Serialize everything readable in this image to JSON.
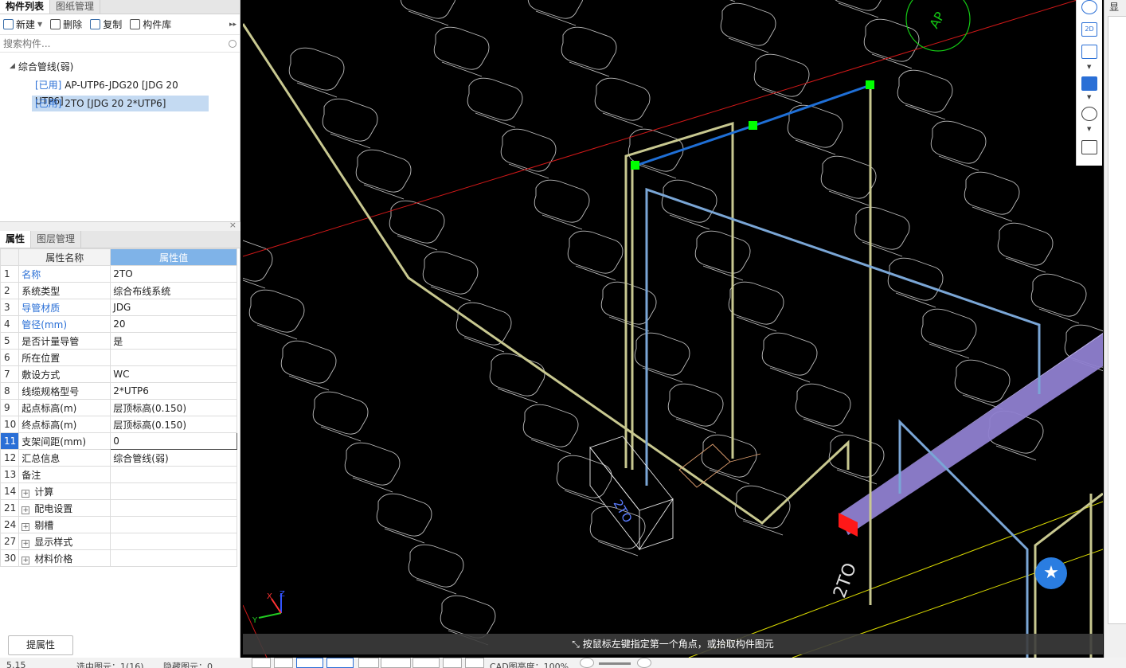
{
  "left_top": {
    "tabs": [
      "构件列表",
      "图纸管理"
    ],
    "toolbar": {
      "new": "新建",
      "delete": "删除",
      "copy": "复制",
      "library": "构件库"
    },
    "search_placeholder": "搜索构件...",
    "tree": {
      "root": "综合管线(弱)",
      "items": [
        {
          "tag": "[已用]",
          "label": "AP-UTP6-JDG20 [JDG 20 UTP6]"
        },
        {
          "tag": "[已用]",
          "label": "2TO [JDG 20 2*UTP6]"
        }
      ]
    }
  },
  "props": {
    "close": "×",
    "tabs": [
      "属性",
      "图层管理"
    ],
    "header": {
      "name": "属性名称",
      "value": "属性值"
    },
    "rows": [
      {
        "n": "1",
        "name": "名称",
        "value": "2TO"
      },
      {
        "n": "2",
        "name": "系统类型",
        "value": "综合布线系统"
      },
      {
        "n": "3",
        "name": "导管材质",
        "value": "JDG"
      },
      {
        "n": "4",
        "name": "管径(mm)",
        "value": "20"
      },
      {
        "n": "5",
        "name": "是否计量导管",
        "value": "是"
      },
      {
        "n": "6",
        "name": "所在位置",
        "value": ""
      },
      {
        "n": "7",
        "name": "敷设方式",
        "value": "WC"
      },
      {
        "n": "8",
        "name": "线缆规格型号",
        "value": "2*UTP6"
      },
      {
        "n": "9",
        "name": "起点标高(m)",
        "value": "层顶标高(0.150)"
      },
      {
        "n": "10",
        "name": "终点标高(m)",
        "value": "层顶标高(0.150)"
      },
      {
        "n": "11",
        "name": "支架间距(mm)",
        "value": "0"
      },
      {
        "n": "12",
        "name": "汇总信息",
        "value": "综合管线(弱)"
      },
      {
        "n": "13",
        "name": "备注",
        "value": ""
      },
      {
        "n": "14",
        "name": "计算",
        "value": ""
      },
      {
        "n": "21",
        "name": "配电设置",
        "value": ""
      },
      {
        "n": "24",
        "name": "剔槽",
        "value": ""
      },
      {
        "n": "27",
        "name": "显示样式",
        "value": ""
      },
      {
        "n": "30",
        "name": "材料价格",
        "value": ""
      }
    ]
  },
  "extract_button": "提属性",
  "canvas": {
    "hint": "按鼠标左键指定第一个角点，或拾取构件图元",
    "labels": {
      "ap": "AP",
      "tag1": "2TO",
      "tag2": "2TO",
      "axis_x": "X",
      "axis_y": "Y",
      "axis_z": "Z"
    }
  },
  "right_toolbar": {
    "view2d": "2D"
  },
  "right_panel": {
    "tab": "显示"
  },
  "status": {
    "coord": "5.15",
    "selected": "选中图元：1(16)",
    "hidden": "隐藏图元：0",
    "cad_brightness": "CAD图亮度：100%"
  },
  "colors": {
    "accent": "#2a6fd6",
    "pipe_yellow": "#c8c890",
    "pipe_blue": "#7aa6d6",
    "selected_pipe": "#1f6fd6",
    "grip": "#00ff00",
    "tray_purple": "#8f7fd0",
    "red_line": "#d01818"
  }
}
